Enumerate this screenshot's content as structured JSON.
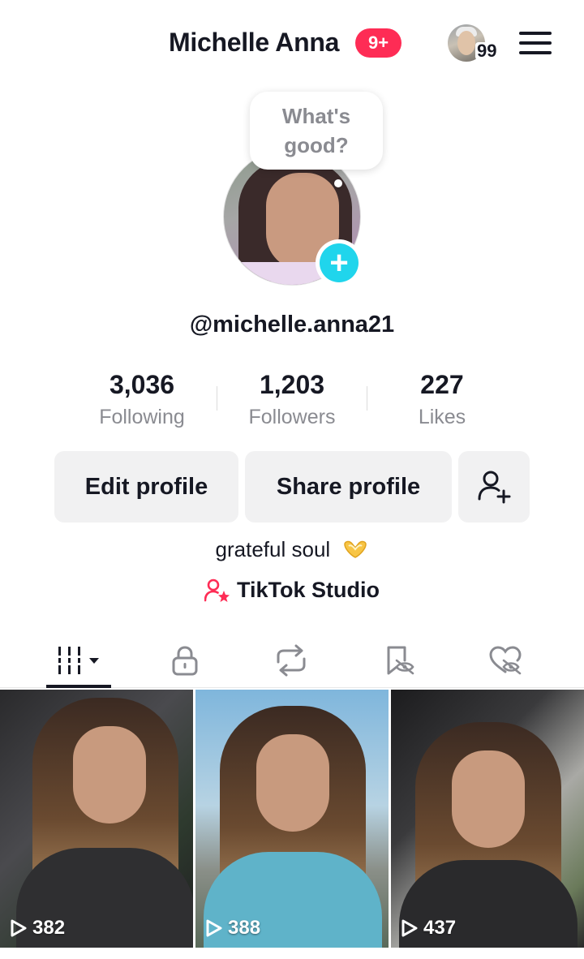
{
  "header": {
    "title": "Michelle Anna",
    "notification_badge": "9+",
    "mini_avatar_count": "99",
    "menu_icon": "hamburger-menu-icon"
  },
  "profile": {
    "bubble_text": "What's good?",
    "username": "@michelle.anna21",
    "add_icon": "plus-icon"
  },
  "stats": [
    {
      "value": "3,036",
      "label": "Following"
    },
    {
      "value": "1,203",
      "label": "Followers"
    },
    {
      "value": "227",
      "label": "Likes"
    }
  ],
  "actions": {
    "edit_label": "Edit profile",
    "share_label": "Share profile",
    "add_friend_icon": "add-friend-icon"
  },
  "bio": {
    "text": "grateful soul",
    "emoji": "heart-hands-emoji",
    "studio_label": "TikTok Studio",
    "studio_icon": "person-star-icon"
  },
  "tabs": [
    {
      "icon": "videos-grid-icon",
      "active": true
    },
    {
      "icon": "lock-icon",
      "active": false
    },
    {
      "icon": "repost-icon",
      "active": false
    },
    {
      "icon": "saved-hidden-icon",
      "active": false
    },
    {
      "icon": "liked-hidden-icon",
      "active": false
    }
  ],
  "videos": [
    {
      "views": "382"
    },
    {
      "views": "388"
    },
    {
      "views": "437"
    }
  ],
  "colors": {
    "accent_red": "#fe2c55",
    "accent_cyan": "#20d5ec",
    "text_primary": "#161823",
    "text_secondary": "#8a8b91",
    "button_bg": "#f1f1f2"
  }
}
